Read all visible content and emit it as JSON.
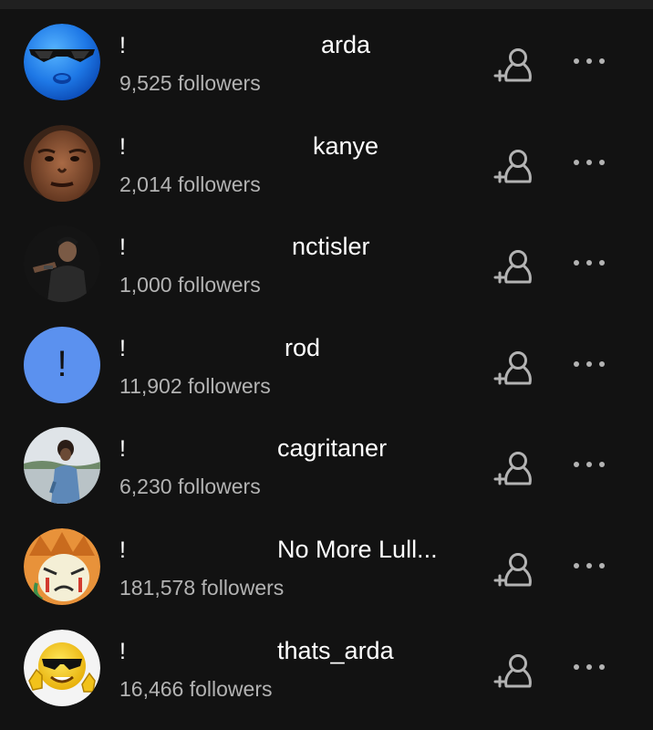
{
  "users": [
    {
      "prefix": "!",
      "name": "arda",
      "followers": "9,525 followers",
      "avatar": "blue-emoji-sunglasses"
    },
    {
      "prefix": "!",
      "name": "kanye",
      "followers": "2,014 followers",
      "avatar": "photo-face"
    },
    {
      "prefix": "!",
      "name": "nctisler",
      "followers": "1,000 followers",
      "avatar": "photo-person-dark"
    },
    {
      "prefix": "!",
      "name": "rod",
      "followers": "11,902 followers",
      "avatar": "exclamation-placeholder",
      "avatar_text": "!"
    },
    {
      "prefix": "!",
      "name": "cagritaner",
      "followers": "6,230 followers",
      "avatar": "photo-person-outdoors"
    },
    {
      "prefix": "!",
      "name": "No More Lull...",
      "followers": "181,578 followers",
      "avatar": "cartoon-crying-face"
    },
    {
      "prefix": "!",
      "name": "thats_arda",
      "followers": "16,466 followers",
      "avatar": "emoji-sunglasses-thumbs-up"
    }
  ],
  "colors": {
    "background": "#121212",
    "text_primary": "#ffffff",
    "text_secondary": "#b3b3b3",
    "icon": "#b3b3b3",
    "placeholder_avatar": "#5b91ef"
  },
  "icons": {
    "follow": "add-person-icon",
    "more": "more-options-icon"
  }
}
